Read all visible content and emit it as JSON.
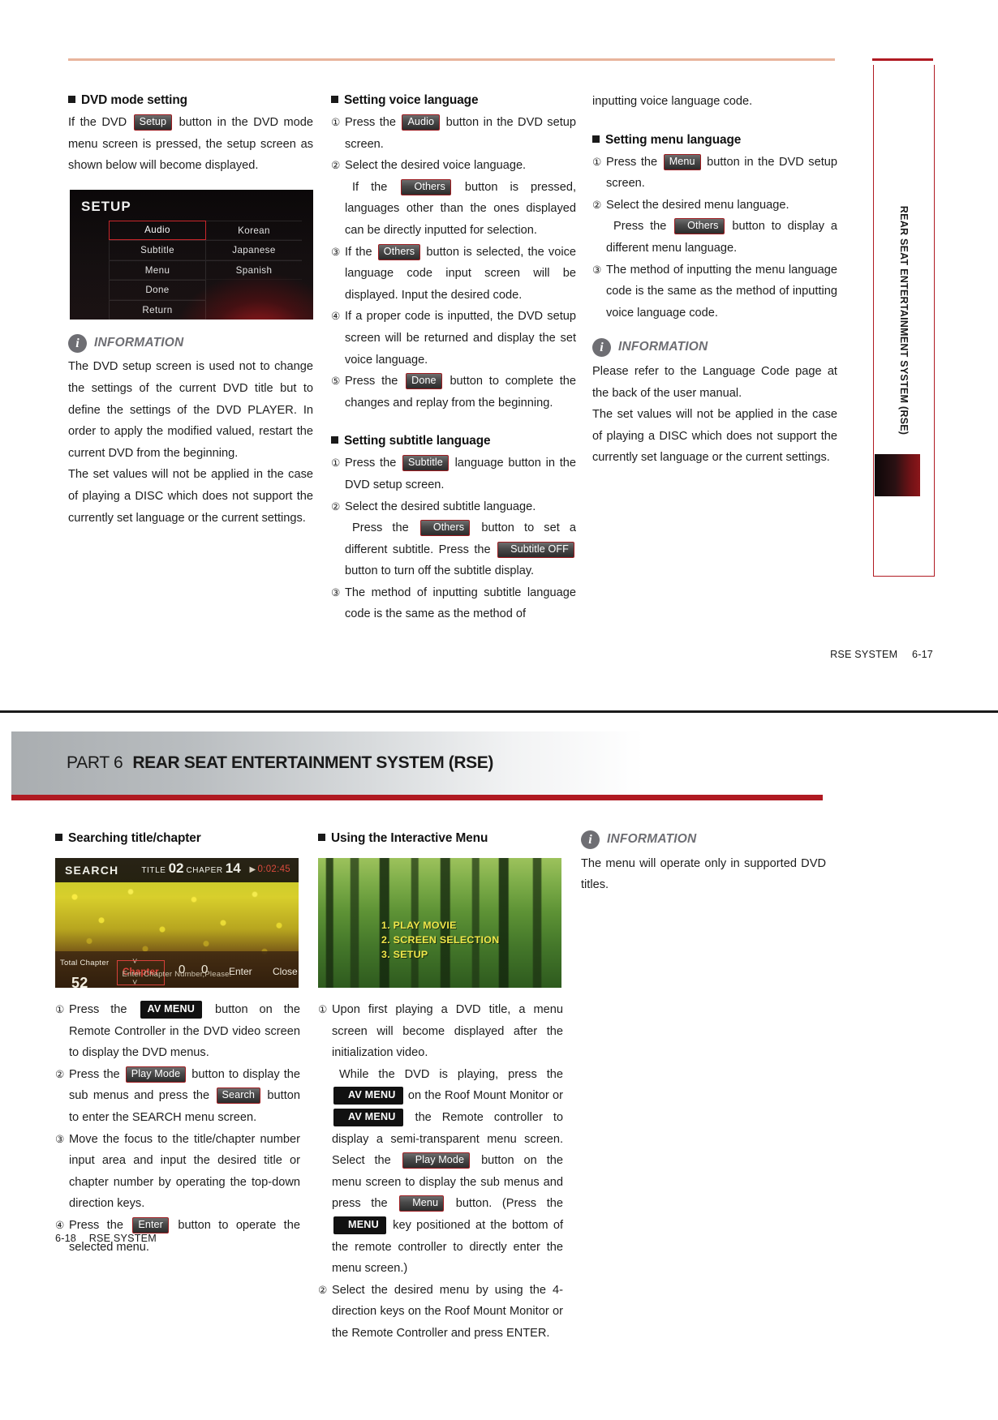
{
  "top_page": {
    "footer": {
      "label": "RSE SYSTEM",
      "page": "6-17"
    },
    "vertical_tab": "REAR SEAT ENTERTAINMENT SYSTEM (RSE)",
    "col_a": {
      "heading": "DVD mode setting",
      "p1_pre": "If the DVD",
      "p1_key": "Setup",
      "p1_post": "button in the DVD mode menu screen is pressed, the setup screen as shown below will become displayed.",
      "setup_screen": {
        "title": "SETUP",
        "left_items": [
          "Audio",
          "Subtitle",
          "Menu",
          "Done",
          "Return"
        ],
        "right_items": [
          "Korean",
          "Japanese",
          "Spanish",
          "",
          ""
        ],
        "selected": "Audio"
      },
      "info_title": "INFORMATION",
      "info_p1": "The DVD setup screen is used not to change the settings of the current DVD title but to define the settings of the DVD PLAYER. In order to apply the modified valued, restart the current DVD from the beginning.",
      "info_p2": "The set values will not be applied in the case of  playing a DISC which does not support the currently set language or the current settings."
    },
    "col_b": {
      "heading_voice": "Setting voice language",
      "v1_pre": "Press the",
      "v1_key": "Audio",
      "v1_post": "button in the DVD setup screen.",
      "v2_main": "Select the desired voice language.",
      "v2_sub_pre": "If the",
      "v2_key": "Others",
      "v2_sub_post": "button is pressed, languages other than the ones displayed can be directly inputted for selection.",
      "v3_pre": "If the",
      "v3_key": "Others",
      "v3_post": "button is selected, the voice language code input screen will be displayed. Input the desired code.",
      "v4": "If a proper code is inputted, the DVD setup screen will be returned and display the set voice language.",
      "v5_pre": "Press the",
      "v5_key": "Done",
      "v5_post": "button to complete the changes and replay from the beginning.",
      "heading_subtitle": "Setting subtitle language",
      "s1_pre": "Press the",
      "s1_key": "Subtitle",
      "s1_post": "language button in the DVD setup screen.",
      "s2_main": "Select the desired subtitle language.",
      "s2_pre": "Press the",
      "s2_key1": "Others",
      "s2_mid": "button to set a different subtitle. Press the",
      "s2_key2": "Subtitle OFF",
      "s2_post": "button to turn off the subtitle display.",
      "s3": "The method of inputting subtitle language code is the same as the method of"
    },
    "col_c": {
      "continuation": "inputting voice language code.",
      "heading_menu": "Setting menu language",
      "m1_pre": "Press the",
      "m1_key": "Menu",
      "m1_post": "button in the DVD setup screen.",
      "m2_main": "Select the desired menu language.",
      "m2_pre": "Press the",
      "m2_key": "Others",
      "m2_post": "button to display a different menu language.",
      "m3": "The method of inputting the menu language code is the same as the method of inputting voice language code.",
      "info_title": "INFORMATION",
      "info_p1": "Please refer to the Language Code page at the back of the user manual.",
      "info_p2": "The set values will not be applied in the case of  playing a DISC which does not support the currently set language or the current settings."
    }
  },
  "bottom_page": {
    "banner": {
      "part": "PART 6",
      "title": "REAR SEAT ENTERTAINMENT SYSTEM (RSE)"
    },
    "footer": {
      "page": "6-18",
      "label": "RSE SYSTEM"
    },
    "col_a": {
      "heading": "Searching title/chapter",
      "search_screen": {
        "label": "SEARCH",
        "title_word": "TITLE",
        "title_num": "02",
        "chapter_word": "CHAPER",
        "chapter_num": "14",
        "time": "0:02:45",
        "total_chapter_label": "Total Chapter",
        "total_chapter_value": "52",
        "chapter_button": "Chapter",
        "digit1": "0",
        "digit2": "0",
        "enter": "Enter",
        "close": "Close",
        "hint": "Enter Chapter Number,Please."
      },
      "i1_pre": "Press the",
      "i1_key": "AV MENU",
      "i1_post": "button on the Remote Controller in the DVD video screen to display the DVD menus.",
      "i2_pre": "Press the",
      "i2_key1": "Play Mode",
      "i2_mid": "button to display the sub menus and press the",
      "i2_key2": "Search",
      "i2_post": "button to enter the SEARCH menu screen.",
      "i3": "Move the focus to the title/chapter number input area and input the desired title or chapter number by operating the top-down direction keys.",
      "i4_pre": "Press the",
      "i4_key": "Enter",
      "i4_post": "button to operate the selected menu."
    },
    "col_b": {
      "heading": "Using the Interactive Menu",
      "menu_screen": {
        "items": [
          "1. PLAY MOVIE",
          "2. SCREEN SELECTION",
          "3. SETUP"
        ]
      },
      "u1_main": "Upon first playing a DVD title, a menu screen will become displayed after the initialization video.",
      "u1_s1": "While the DVD is playing, press the",
      "u1_key1": "AV MENU",
      "u1_s2": "on the Roof Mount Monitor or",
      "u1_key2": "AV MENU",
      "u1_s3": "the Remote controller to display a semi-transparent menu screen. Select the",
      "u1_key3": "Play Mode",
      "u1_s4": "button on the menu screen to display the sub menus and press the",
      "u1_key4": "Menu",
      "u1_s5": "button. (Press the",
      "u1_key5": "MENU",
      "u1_s6": "key positioned at the bottom of the remote controller to directly enter the menu screen.)",
      "u2": "Select the desired menu by using the 4-direction keys on the Roof Mount Monitor or the Remote Controller and press ENTER."
    },
    "col_c": {
      "info_title": "INFORMATION",
      "info_p1": "The menu will operate only in supported DVD titles."
    }
  }
}
